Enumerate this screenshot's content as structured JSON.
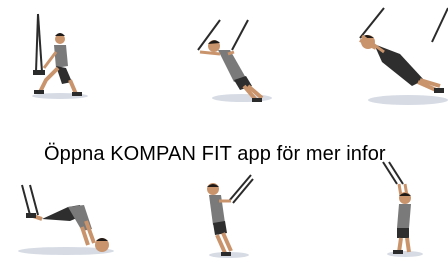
{
  "banner": {
    "text": "Öppna KOMPAN FIT app för mer infor"
  },
  "colors": {
    "strap": "#2b2b2b",
    "shirt": "#7a7a7a",
    "shorts": "#2e2e2e",
    "skin": "#c9946c",
    "hair": "#1f1a17",
    "shadow": "#c4ccd8",
    "background": "#ffffff"
  },
  "figures": [
    {
      "icon": "lunge-exercise-icon"
    },
    {
      "icon": "chest-press-exercise-icon"
    },
    {
      "icon": "pushup-exercise-icon"
    },
    {
      "icon": "pike-exercise-icon"
    },
    {
      "icon": "row-exercise-icon"
    },
    {
      "icon": "overhead-pull-exercise-icon"
    }
  ]
}
